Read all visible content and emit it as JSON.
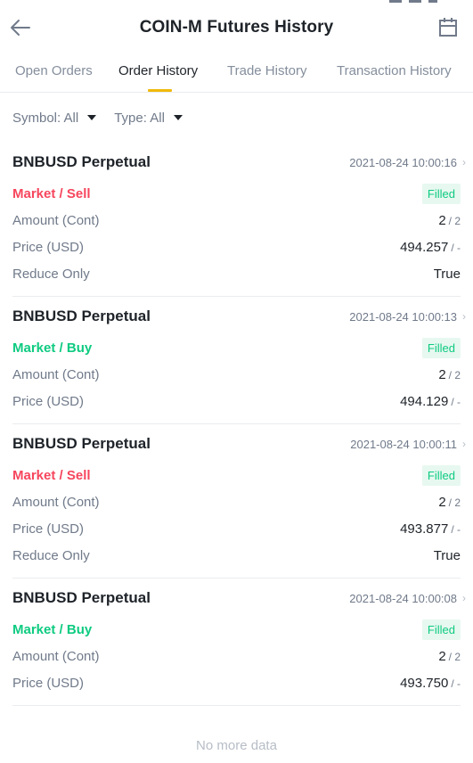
{
  "header": {
    "title": "COIN-M Futures History",
    "back_icon": "arrow-left-icon",
    "calendar_icon": "calendar-icon"
  },
  "tabs": [
    {
      "label": "Open Orders",
      "active": false
    },
    {
      "label": "Order History",
      "active": true
    },
    {
      "label": "Trade History",
      "active": false
    },
    {
      "label": "Transaction History",
      "active": false
    }
  ],
  "filters": {
    "symbol": "Symbol: All",
    "type": "Type: All"
  },
  "labels": {
    "amount": "Amount (Cont)",
    "price": "Price (USD)",
    "reduce_only": "Reduce Only"
  },
  "orders": [
    {
      "symbol": "BNBUSD Perpetual",
      "time": "2021-08-24 10:00:16",
      "side": "Market / Sell",
      "status": "Filled",
      "amount": "2",
      "amount_total": "/ 2",
      "price": "494.257",
      "price_sub": "/ -",
      "reduce_only": "True"
    },
    {
      "symbol": "BNBUSD Perpetual",
      "time": "2021-08-24 10:00:13",
      "side": "Market / Buy",
      "status": "Filled",
      "amount": "2",
      "amount_total": "/ 2",
      "price": "494.129",
      "price_sub": "/ -"
    },
    {
      "symbol": "BNBUSD Perpetual",
      "time": "2021-08-24 10:00:11",
      "side": "Market / Sell",
      "status": "Filled",
      "amount": "2",
      "amount_total": "/ 2",
      "price": "493.877",
      "price_sub": "/ -",
      "reduce_only": "True"
    },
    {
      "symbol": "BNBUSD Perpetual",
      "time": "2021-08-24 10:00:08",
      "side": "Market / Buy",
      "status": "Filled",
      "amount": "2",
      "amount_total": "/ 2",
      "price": "493.750",
      "price_sub": "/ -"
    }
  ],
  "footer": {
    "no_more": "No more data"
  },
  "colors": {
    "accent": "#f0b90b",
    "sell": "#f6465d",
    "buy": "#0ecb81"
  }
}
